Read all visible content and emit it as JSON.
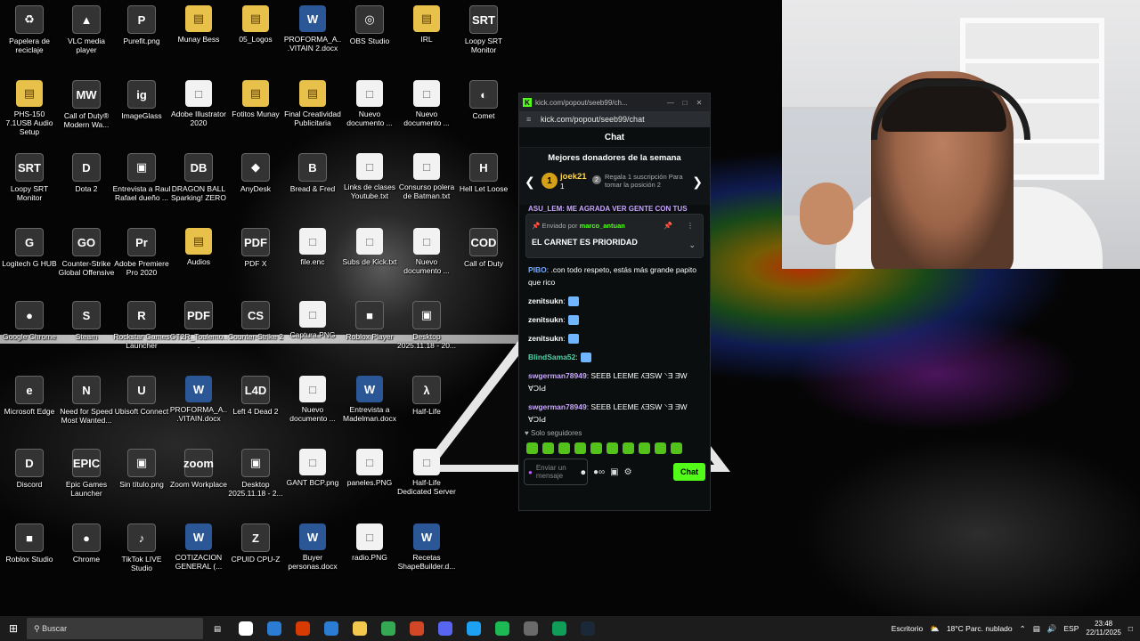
{
  "desktop_icons": [
    {
      "label": "Papelera de reciclaje",
      "glyph": "♻",
      "type": "app",
      "col": 0,
      "row": 0
    },
    {
      "label": "VLC media player",
      "glyph": "▲",
      "type": "app",
      "col": 1,
      "row": 0
    },
    {
      "label": "Purefit.png",
      "glyph": "P",
      "type": "app",
      "col": 2,
      "row": 0
    },
    {
      "label": "Munay Bess",
      "glyph": "▤",
      "type": "folder",
      "col": 3,
      "row": 0
    },
    {
      "label": "05_Logos",
      "glyph": "▤",
      "type": "folder",
      "col": 4,
      "row": 0
    },
    {
      "label": "PROFORMA_A...VITAIN 2.docx",
      "glyph": "W",
      "type": "word",
      "col": 5,
      "row": 0
    },
    {
      "label": "OBS Studio",
      "glyph": "◎",
      "type": "app",
      "col": 6,
      "row": 0
    },
    {
      "label": "IRL",
      "glyph": "▤",
      "type": "folder",
      "col": 7,
      "row": 0
    },
    {
      "label": "Loopy SRT Monitor",
      "glyph": "SRT",
      "type": "app",
      "col": 8,
      "row": 0
    },
    {
      "label": "PHS-150 7.1USB Audio Setup",
      "glyph": "▤",
      "type": "folder",
      "col": 0,
      "row": 1
    },
    {
      "label": "Call of Duty® Modern Wa...",
      "glyph": "MW",
      "type": "app",
      "col": 1,
      "row": 1
    },
    {
      "label": "ImageGlass",
      "glyph": "ig",
      "type": "app",
      "col": 2,
      "row": 1
    },
    {
      "label": "Adobe Illustrator 2020",
      "glyph": "□",
      "type": "doc",
      "col": 3,
      "row": 1
    },
    {
      "label": "Fotitos Munay",
      "glyph": "▤",
      "type": "folder",
      "col": 4,
      "row": 1
    },
    {
      "label": "Final Creatividad Publicitaria",
      "glyph": "▤",
      "type": "folder",
      "col": 5,
      "row": 1
    },
    {
      "label": "Nuevo documento ...",
      "glyph": "□",
      "type": "doc",
      "col": 6,
      "row": 1
    },
    {
      "label": "Nuevo documento ...",
      "glyph": "□",
      "type": "doc",
      "col": 7,
      "row": 1
    },
    {
      "label": "Comet",
      "glyph": "◐",
      "type": "app",
      "col": 8,
      "row": 1
    },
    {
      "label": "Loopy SRT Monitor",
      "glyph": "SRT",
      "type": "app",
      "col": 0,
      "row": 2
    },
    {
      "label": "Dota 2",
      "glyph": "D",
      "type": "app",
      "col": 1,
      "row": 2
    },
    {
      "label": "Entrevista a Raul Rafael dueño ...",
      "glyph": "▣",
      "type": "app",
      "col": 2,
      "row": 2
    },
    {
      "label": "DRAGON BALL Sparking! ZERO",
      "glyph": "DB",
      "type": "app",
      "col": 3,
      "row": 2
    },
    {
      "label": "AnyDesk",
      "glyph": "◆",
      "type": "app",
      "col": 4,
      "row": 2
    },
    {
      "label": "Bread & Fred",
      "glyph": "B",
      "type": "app",
      "col": 5,
      "row": 2
    },
    {
      "label": "Links de clases Youtube.txt",
      "glyph": "□",
      "type": "doc",
      "col": 6,
      "row": 2
    },
    {
      "label": "Consurso polera de Batman.txt",
      "glyph": "□",
      "type": "doc",
      "col": 7,
      "row": 2
    },
    {
      "label": "Hell Let Loose",
      "glyph": "H",
      "type": "app",
      "col": 8,
      "row": 2
    },
    {
      "label": "Logitech G HUB",
      "glyph": "G",
      "type": "app",
      "col": 0,
      "row": 3
    },
    {
      "label": "Counter-Strike Global Offensive",
      "glyph": "GO",
      "type": "app",
      "col": 1,
      "row": 3
    },
    {
      "label": "Adobe Premiere Pro 2020",
      "glyph": "Pr",
      "type": "app",
      "col": 2,
      "row": 3
    },
    {
      "label": "Audios",
      "glyph": "▤",
      "type": "folder",
      "col": 3,
      "row": 3
    },
    {
      "label": "PDF X",
      "glyph": "PDF",
      "type": "app",
      "col": 4,
      "row": 3
    },
    {
      "label": "file.enc",
      "glyph": "□",
      "type": "doc",
      "col": 5,
      "row": 3
    },
    {
      "label": "Subs de Kick.txt",
      "glyph": "□",
      "type": "doc",
      "col": 6,
      "row": 3
    },
    {
      "label": "Nuevo documento ...",
      "glyph": "□",
      "type": "doc",
      "col": 7,
      "row": 3
    },
    {
      "label": "Call of Duty",
      "glyph": "COD",
      "type": "app",
      "col": 8,
      "row": 3
    },
    {
      "label": "Google Chrome",
      "glyph": "●",
      "type": "app",
      "col": 0,
      "row": 4
    },
    {
      "label": "Steam",
      "glyph": "S",
      "type": "app",
      "col": 1,
      "row": 4
    },
    {
      "label": "Rockstar Games Launcher",
      "glyph": "R",
      "type": "app",
      "col": 2,
      "row": 4
    },
    {
      "label": "GT2R_Toulemo...",
      "glyph": "PDF",
      "type": "app",
      "col": 3,
      "row": 4
    },
    {
      "label": "Counter-Strike 2",
      "glyph": "CS",
      "type": "app",
      "col": 4,
      "row": 4
    },
    {
      "label": "Captura.PNG",
      "glyph": "□",
      "type": "doc",
      "col": 5,
      "row": 4
    },
    {
      "label": "Roblox Player",
      "glyph": "■",
      "type": "app",
      "col": 6,
      "row": 4
    },
    {
      "label": "Desktop 2025.11.18 - 20...",
      "glyph": "▣",
      "type": "app",
      "col": 7,
      "row": 4
    },
    {
      "label": "Microsoft Edge",
      "glyph": "e",
      "type": "app",
      "col": 0,
      "row": 5
    },
    {
      "label": "Need for Speed Most Wanted...",
      "glyph": "N",
      "type": "app",
      "col": 1,
      "row": 5
    },
    {
      "label": "Ubisoft Connect",
      "glyph": "U",
      "type": "app",
      "col": 2,
      "row": 5
    },
    {
      "label": "PROFORMA_A...VITAIN.docx",
      "glyph": "W",
      "type": "word",
      "col": 3,
      "row": 5
    },
    {
      "label": "Left 4 Dead 2",
      "glyph": "L4D",
      "type": "app",
      "col": 4,
      "row": 5
    },
    {
      "label": "Nuevo documento ...",
      "glyph": "□",
      "type": "doc",
      "col": 5,
      "row": 5
    },
    {
      "label": "Entrevista a Madelman.docx",
      "glyph": "W",
      "type": "word",
      "col": 6,
      "row": 5
    },
    {
      "label": "Half-Life",
      "glyph": "λ",
      "type": "app",
      "col": 7,
      "row": 5
    },
    {
      "label": "Discord",
      "glyph": "D",
      "type": "app",
      "col": 0,
      "row": 6
    },
    {
      "label": "Epic Games Launcher",
      "glyph": "EPIC",
      "type": "app",
      "col": 1,
      "row": 6
    },
    {
      "label": "Sin título.png",
      "glyph": "▣",
      "type": "app",
      "col": 2,
      "row": 6
    },
    {
      "label": "Zoom Workplace",
      "glyph": "zoom",
      "type": "app",
      "col": 3,
      "row": 6
    },
    {
      "label": "Desktop 2025.11.18 - 2...",
      "glyph": "▣",
      "type": "app",
      "col": 4,
      "row": 6
    },
    {
      "label": "GANT BCP.png",
      "glyph": "□",
      "type": "doc",
      "col": 5,
      "row": 6
    },
    {
      "label": "paneles.PNG",
      "glyph": "□",
      "type": "doc",
      "col": 6,
      "row": 6
    },
    {
      "label": "Half-Life Dedicated Server",
      "glyph": "□",
      "type": "doc",
      "col": 7,
      "row": 6
    },
    {
      "label": "Roblox Studio",
      "glyph": "■",
      "type": "app",
      "col": 0,
      "row": 7
    },
    {
      "label": "Chrome",
      "glyph": "●",
      "type": "app",
      "col": 1,
      "row": 7
    },
    {
      "label": "TikTok LIVE Studio",
      "glyph": "♪",
      "type": "app",
      "col": 2,
      "row": 7
    },
    {
      "label": "COTIZACION GENERAL (...",
      "glyph": "W",
      "type": "word",
      "col": 3,
      "row": 7
    },
    {
      "label": "CPUID CPU-Z",
      "glyph": "Z",
      "type": "app",
      "col": 4,
      "row": 7
    },
    {
      "label": "Buyer personas.docx",
      "glyph": "W",
      "type": "word",
      "col": 5,
      "row": 7
    },
    {
      "label": "radio.PNG",
      "glyph": "□",
      "type": "doc",
      "col": 6,
      "row": 7
    },
    {
      "label": "Recetas ShapeBuilder.d...",
      "glyph": "W",
      "type": "word",
      "col": 7,
      "row": 7
    }
  ],
  "browser": {
    "title": "kick.com/popout/seeb99/ch...",
    "url": "kick.com/popout/seeb99/chat",
    "chat_header": "Chat",
    "donors_title": "Mejores donadores de la semana",
    "top_donor": {
      "rank": "1",
      "name": "joek21",
      "count": "1"
    },
    "gift_rank": "2",
    "gift_text": "Regala 1 suscripción Para tomar la posición 2",
    "cut_message": "ASU_LEM: ME AGRADA VER GENTE CON TUS",
    "pinned": {
      "sent_by": "Enviado por",
      "user": "marco_antuan",
      "message": "EL CARNET ES PRIORIDAD"
    },
    "messages": [
      {
        "user": "PIBO",
        "text": ": .con todo respeto, estás más grande papito que rico",
        "color": "#6fa8ff"
      },
      {
        "user": "zenitsukn",
        "text": ":",
        "color": "#ffffff",
        "emote": true
      },
      {
        "user": "zenitsukn",
        "text": ":",
        "color": "#ffffff",
        "emote": true
      },
      {
        "user": "zenitsukn",
        "text": ":",
        "color": "#ffffff",
        "emote": true
      },
      {
        "user": "BlindSama52",
        "text": ":",
        "color": "#4fd3a5",
        "emote": true
      },
      {
        "user": "swgerman78949",
        "text": ": SEEB LEEME ʎƎSW ⸌Ǝ ƎW ∀ƆIԀ",
        "color": "#c9a7ff"
      },
      {
        "user": "swgerman78949",
        "text": ": SEEB LEEME ʎƎSW ⸌Ǝ ƎW ∀ƆIԀ",
        "color": "#c9a7ff"
      }
    ],
    "followers_only": "Solo seguidores",
    "input_placeholder": "Enviar un mensaje",
    "chat_button": "Chat"
  },
  "taskbar": {
    "search_text": "Buscar",
    "desktop_label": "Escritorio",
    "weather": "18°C  Parc. nublado",
    "lang": "ESP",
    "time": "23:48",
    "date": "22/11/2025",
    "pinned_colors": [
      "#ffffff",
      "#2b7cd3",
      "#d83b01",
      "#2b7cd3",
      "#f2c94c",
      "#34a853",
      "#d24726",
      "#5865f2",
      "#1da1f2",
      "#1db954",
      "#6a6a6a",
      "#0f9d58",
      "#1b2838"
    ]
  }
}
